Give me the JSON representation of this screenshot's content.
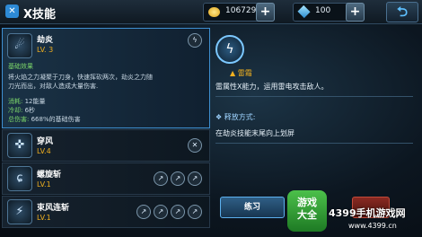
{
  "header": {
    "title": "X技能",
    "title_icon": "x-skill-icon",
    "gold": "106729",
    "gems": "100",
    "plus_label": "+",
    "back_label": "⮌"
  },
  "skills": [
    {
      "name": "劫炎",
      "level": "LV. 3",
      "icon": "tornado-skill-icon",
      "glyph": "☄",
      "selected": true,
      "details": {
        "section_label": "基础效果",
        "description_1": "将火焰之力凝聚于刀身，快速挥砍两次，劫炎之力随",
        "description_2": "刀光而出，对敌人造成大量伤害.",
        "energy_label": "消耗:",
        "energy_value": "12能量",
        "cooldown_label": "冷却:",
        "cooldown_value": "6秒",
        "damage_label": "总伤害:",
        "damage_value": "668%的基础伤害"
      }
    },
    {
      "name": "穿风",
      "level": "LV.4",
      "icon": "wind-pierce-skill-icon",
      "glyph": "✜"
    },
    {
      "name": "螺旋斩",
      "level": "LV.1",
      "icon": "spiral-slash-skill-icon",
      "glyph": "ɕ"
    },
    {
      "name": "束风连斩",
      "level": "LV.1",
      "icon": "chain-slash-skill-icon",
      "glyph": "⚡"
    }
  ],
  "rune": {
    "name": "雷霜",
    "description": "雷属性X能力，运用雷电攻击敌人。",
    "release_label": "释放方式:",
    "release_desc": "在劫炎技能末尾向上划屏",
    "glyph": "ϟ"
  },
  "actions": {
    "practice_label": "练习"
  },
  "watermark": {
    "logo_text_1": "游戏",
    "logo_text_2": "大全",
    "site_title": "4399手机游戏网",
    "site_url": "www.4399.cn"
  }
}
